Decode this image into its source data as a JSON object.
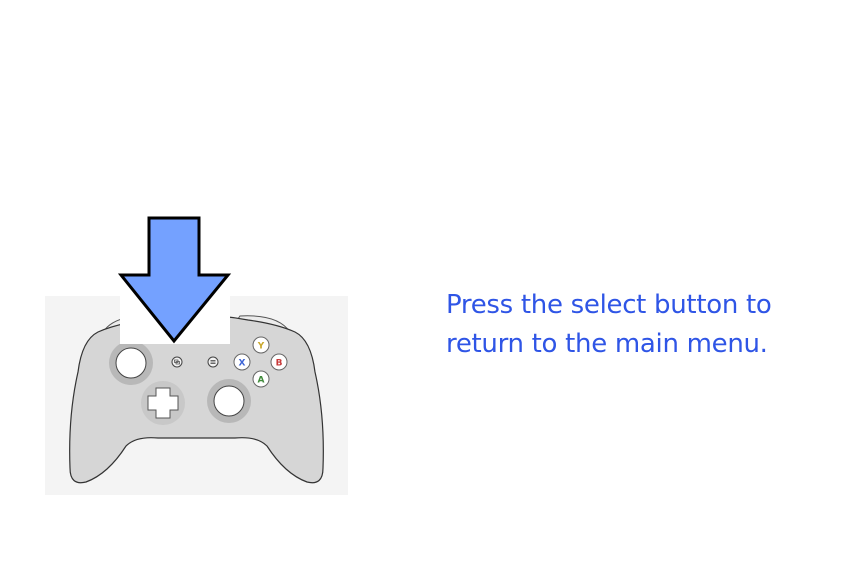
{
  "instruction": {
    "text": "Press the select button to return to the main menu.",
    "color": "#2f55e6"
  },
  "controller": {
    "face_buttons": {
      "y": {
        "label": "Y",
        "color": "#c9a72c"
      },
      "x": {
        "label": "X",
        "color": "#3c64d6"
      },
      "b": {
        "label": "B",
        "color": "#c83a3a"
      },
      "a": {
        "label": "A",
        "color": "#3f8a3a"
      }
    },
    "highlighted_button": "select",
    "body_color": "#d6d6d6",
    "panel_color": "#f4f4f4"
  },
  "arrow": {
    "icon": "down-arrow-icon",
    "fill": "#74a1ff",
    "stroke": "#000000"
  }
}
